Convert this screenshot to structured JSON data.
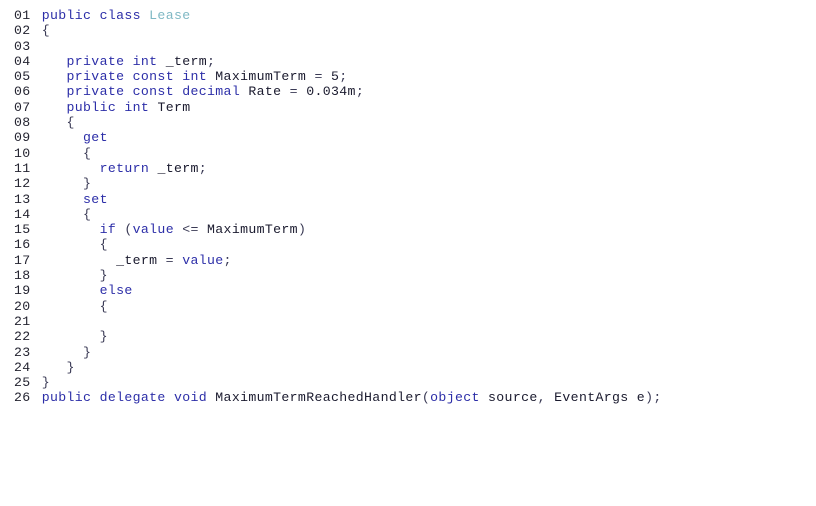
{
  "document": {
    "kind": "code-listing",
    "language": "C#",
    "background_color": "#ffffff",
    "text_color": "#1a1a2e",
    "keyword_color": "#2c2ea8",
    "type_color": "#7fb8c4",
    "line_number_color": "#242431",
    "line_count": 26
  },
  "lines": [
    {
      "number": "01",
      "text": "public class Lease"
    },
    {
      "number": "02",
      "text": "{"
    },
    {
      "number": "03",
      "text": ""
    },
    {
      "number": "04",
      "text": "   private int _term;"
    },
    {
      "number": "05",
      "text": "   private const int MaximumTerm = 5;"
    },
    {
      "number": "06",
      "text": "   private const decimal Rate = 0.034m;"
    },
    {
      "number": "07",
      "text": "   public int Term"
    },
    {
      "number": "08",
      "text": "   {"
    },
    {
      "number": "09",
      "text": "     get"
    },
    {
      "number": "10",
      "text": "     {"
    },
    {
      "number": "11",
      "text": "       return _term;"
    },
    {
      "number": "12",
      "text": "     }"
    },
    {
      "number": "13",
      "text": "     set"
    },
    {
      "number": "14",
      "text": "     {"
    },
    {
      "number": "15",
      "text": "       if (value <= MaximumTerm)"
    },
    {
      "number": "16",
      "text": "       {"
    },
    {
      "number": "17",
      "text": "         _term = value;"
    },
    {
      "number": "18",
      "text": "       }"
    },
    {
      "number": "19",
      "text": "       else"
    },
    {
      "number": "20",
      "text": "       {"
    },
    {
      "number": "21",
      "text": ""
    },
    {
      "number": "22",
      "text": "       }"
    },
    {
      "number": "23",
      "text": "     }"
    },
    {
      "number": "24",
      "text": "   }"
    },
    {
      "number": "25",
      "text": "}"
    },
    {
      "number": "26",
      "text": "public delegate void MaximumTermReachedHandler(object source, EventArgs e);"
    }
  ],
  "tokens": {
    "keywords": [
      "public",
      "class",
      "private",
      "const",
      "int",
      "decimal",
      "get",
      "set",
      "return",
      "if",
      "else",
      "value",
      "delegate",
      "void",
      "object"
    ],
    "types": [
      "Lease"
    ],
    "identifiers": [
      "_term",
      "MaximumTerm",
      "Rate",
      "Term",
      "MaximumTermReachedHandler",
      "source",
      "EventArgs",
      "e"
    ],
    "literals": [
      "5",
      "0.034m"
    ]
  }
}
